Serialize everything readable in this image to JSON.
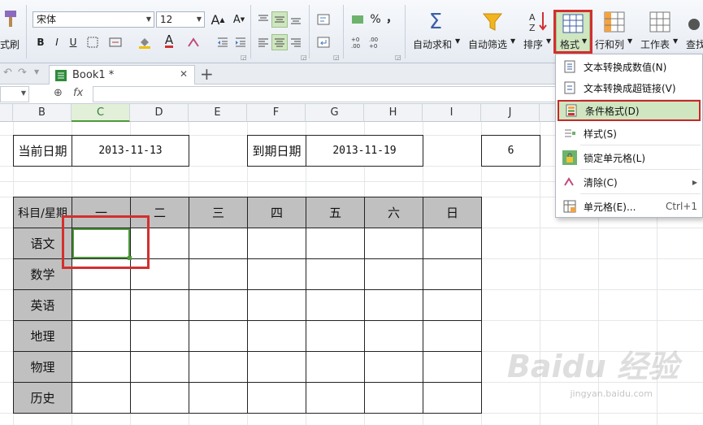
{
  "ribbon": {
    "format_painter_label": "式刷",
    "font_name": "宋体",
    "font_size": "12",
    "grow_font": "A",
    "shrink_font": "A",
    "bold": "B",
    "italic": "I",
    "underline": "U",
    "percent": "%",
    "comma": "，",
    "autosum_label": "自动求和",
    "autofilter_label": "自动筛选",
    "sort_label": "排序",
    "format_label": "格式",
    "rowcol_label": "行和列",
    "sheet_label": "工作表",
    "find_label": "查找"
  },
  "tabs": {
    "book_title": "Book1 *",
    "close": "✕",
    "add": "+"
  },
  "formula_bar": {
    "fx": "fx"
  },
  "columns": [
    "B",
    "C",
    "D",
    "E",
    "F",
    "G",
    "H",
    "I",
    "J"
  ],
  "sheet": {
    "current_date_label": "当前日期",
    "current_date_value": "2013-11-13",
    "due_date_label": "到期日期",
    "due_date_value": "2013-11-19",
    "j_value": "6",
    "header_corner": "科目/星期",
    "days": [
      "一",
      "二",
      "三",
      "四",
      "五",
      "六",
      "日"
    ],
    "subjects": [
      "语文",
      "数学",
      "英语",
      "地理",
      "物理",
      "历史"
    ]
  },
  "menu": {
    "items": [
      {
        "label": "文本转换成数值(N)"
      },
      {
        "label": "文本转换成超链接(V)"
      },
      {
        "label": "条件格式(D)"
      },
      {
        "label": "样式(S)"
      },
      {
        "label": "锁定单元格(L)"
      },
      {
        "label": "清除(C)"
      },
      {
        "label": "单元格(E)...",
        "shortcut": "Ctrl+1"
      }
    ]
  },
  "watermark": {
    "main": "Baidu 经验",
    "sub": "jingyan.baidu.com"
  },
  "colors": {
    "accent_green": "#4e9a3a",
    "highlight_red": "#d32f2f",
    "header_gray": "#c0c0c0"
  }
}
